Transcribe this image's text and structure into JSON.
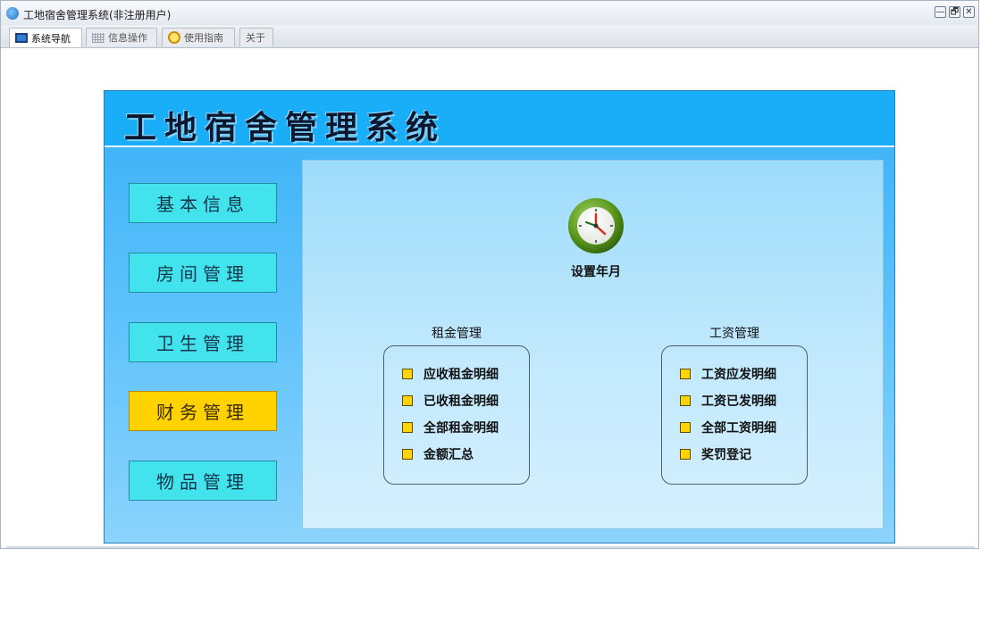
{
  "window": {
    "title": "工地宿舍管理系统(非注册用户)",
    "controls": [
      "—",
      "🗗",
      "✕"
    ]
  },
  "tabs": [
    {
      "label": "系统导航",
      "icon": "monitor-icon",
      "active": true
    },
    {
      "label": "信息操作",
      "icon": "grid-icon",
      "active": false
    },
    {
      "label": "使用指南",
      "icon": "guide-icon",
      "active": false
    },
    {
      "label": "关于",
      "icon": "",
      "active": false
    }
  ],
  "header": {
    "title": "工地宿舍管理系统"
  },
  "nav": [
    {
      "label": "基本信息",
      "active": false
    },
    {
      "label": "房间管理",
      "active": false
    },
    {
      "label": "卫生管理",
      "active": false
    },
    {
      "label": "财务管理",
      "active": true
    },
    {
      "label": "物品管理",
      "active": false
    }
  ],
  "main": {
    "clock_label": "设置年月",
    "rent": {
      "title": "租金管理",
      "items": [
        "应收租金明细",
        "已收租金明细",
        "全部租金明细",
        "金额汇总"
      ]
    },
    "salary": {
      "title": "工资管理",
      "items": [
        "工资应发明细",
        "工资已发明细",
        "全部工资明细",
        "奖罚登记"
      ]
    }
  },
  "colors": {
    "panel_blue": "#19aef7",
    "nav_button": "#42e3ec",
    "nav_active": "#ffd200",
    "checkbox": "#ffd400"
  }
}
